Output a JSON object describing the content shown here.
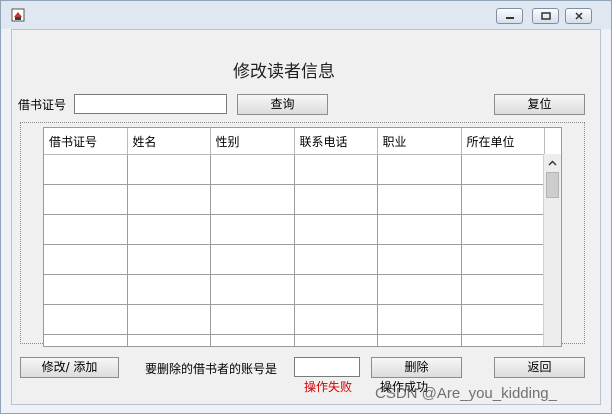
{
  "form": {
    "title": "修改读者信息",
    "card_label": "借书证号",
    "card_value": "",
    "query_label": "查询",
    "reset_label": "复位",
    "columns": [
      "借书证号",
      "姓名",
      "性别",
      "联系电话",
      "职业",
      "所在单位"
    ],
    "rows": [
      [
        "",
        "",
        "",
        "",
        "",
        ""
      ],
      [
        "",
        "",
        "",
        "",
        "",
        ""
      ],
      [
        "",
        "",
        "",
        "",
        "",
        ""
      ],
      [
        "",
        "",
        "",
        "",
        "",
        ""
      ],
      [
        "",
        "",
        "",
        "",
        "",
        ""
      ],
      [
        "",
        "",
        "",
        "",
        "",
        ""
      ],
      [
        "",
        "",
        "",
        "",
        "",
        ""
      ]
    ],
    "modify_label": "修改/ 添加",
    "delete_account_label": "要删除的借书者的账号是",
    "delete_account_value": "",
    "delete_label": "删除",
    "back_label": "返回",
    "fail_text": "操作失败",
    "success_text": "操作成功"
  },
  "watermark": "CSDN @Are_you_kidding_",
  "icons": {
    "app": "java-cup-icon",
    "minimize": "minimize-icon",
    "maximize": "maximize-icon",
    "close": "close-icon",
    "scroll_up": "chevron-up-icon"
  },
  "colors": {
    "error": "#d40000"
  }
}
